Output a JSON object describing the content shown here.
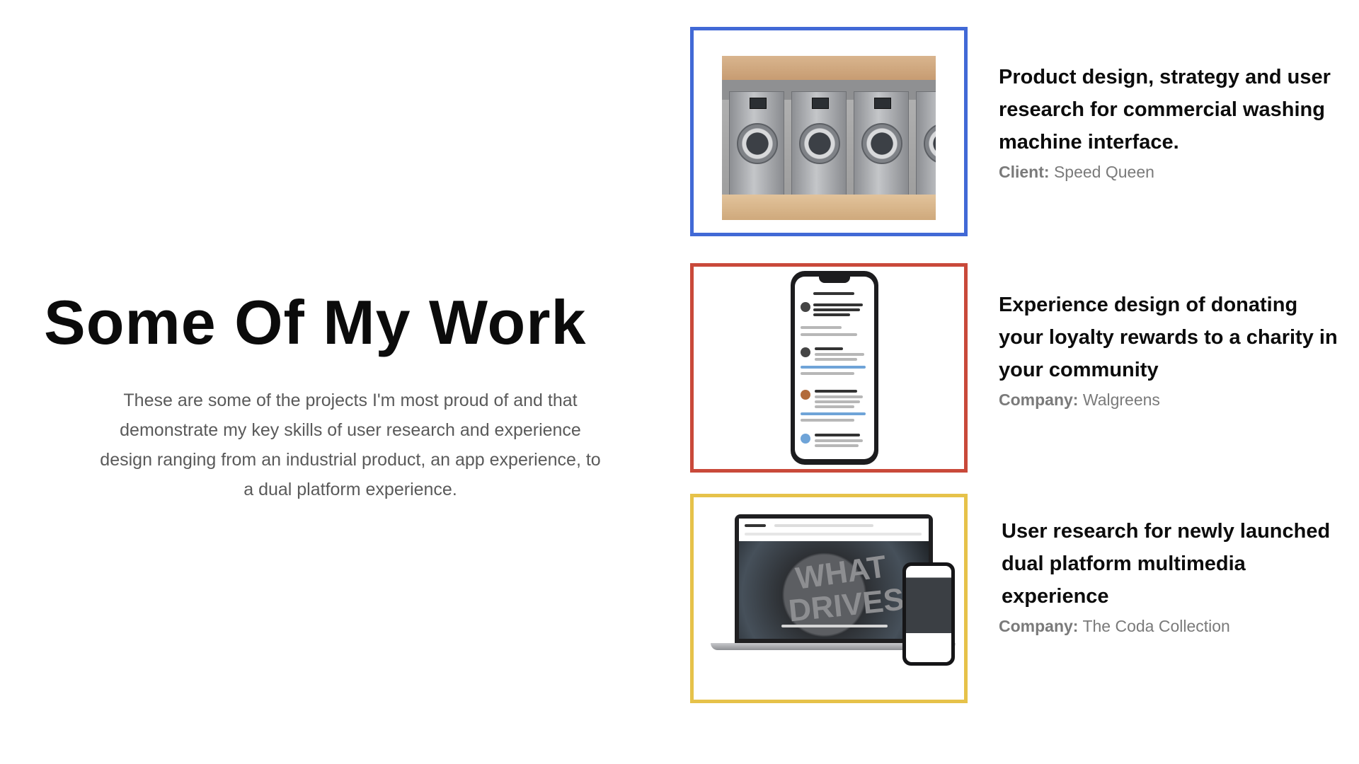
{
  "intro": {
    "title": "Some Of My Work",
    "description": "These are some of the projects I'm most proud of and that demonstrate my key skills of user research and experience design ranging from an industrial product, an app experience, to a dual platform experience."
  },
  "projects": [
    {
      "frame_color": "#4169d6",
      "heading": "Product design, strategy and user research for commercial washing machine interface.",
      "meta_label": "Client:",
      "meta_value": "Speed Queen",
      "image": "commercial-washing-machines"
    },
    {
      "frame_color": "#c9493a",
      "heading": "Experience design of donating your loyalty rewards to a charity in your community",
      "meta_label": "Company:",
      "meta_value": "Walgreens",
      "image": "donation-app-phone-screen"
    },
    {
      "frame_color": "#e6c24a",
      "heading": "User research for newly launched dual platform multimedia experience",
      "meta_label": "Company:",
      "meta_value": "The Coda Collection",
      "image": "laptop-and-phone-website"
    }
  ]
}
